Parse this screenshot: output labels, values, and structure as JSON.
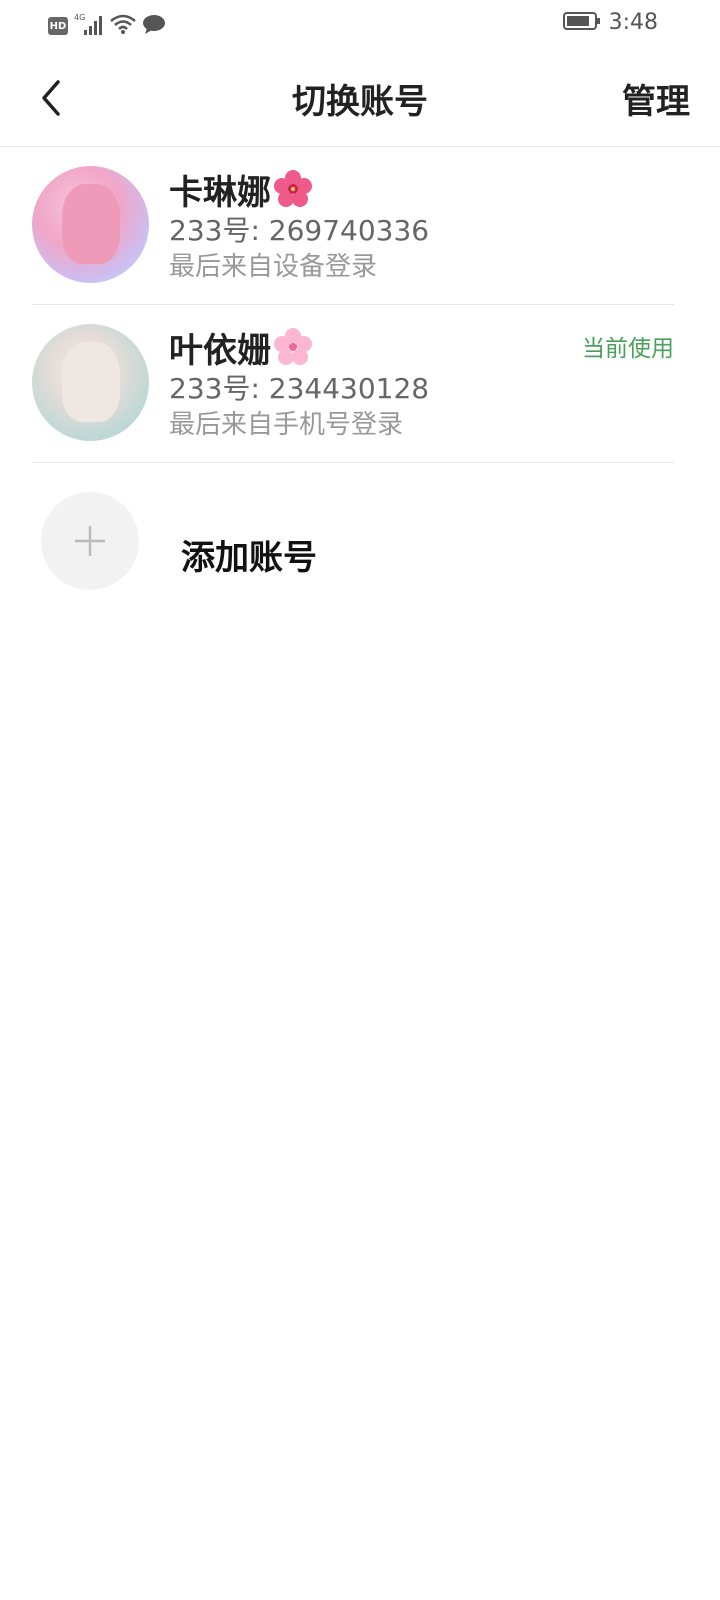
{
  "status_bar": {
    "hd_label": "HD",
    "network_label": "4G",
    "time": "3:48"
  },
  "header": {
    "title": "切换账号",
    "manage_label": "管理",
    "back_icon": "chevron-left-icon"
  },
  "accounts": [
    {
      "name": "卡琳娜",
      "id_text": "233号: 269740336",
      "last_login": "最后来自设备登录",
      "current": false
    },
    {
      "name": "叶依姗",
      "id_text": "233号: 234430128",
      "last_login": "最后来自手机号登录",
      "current": true,
      "current_label": "当前使用"
    }
  ],
  "add_account": {
    "label": "添加账号"
  },
  "colors": {
    "accent_green": "#4aa15c",
    "divider": "#e6e6e6"
  }
}
